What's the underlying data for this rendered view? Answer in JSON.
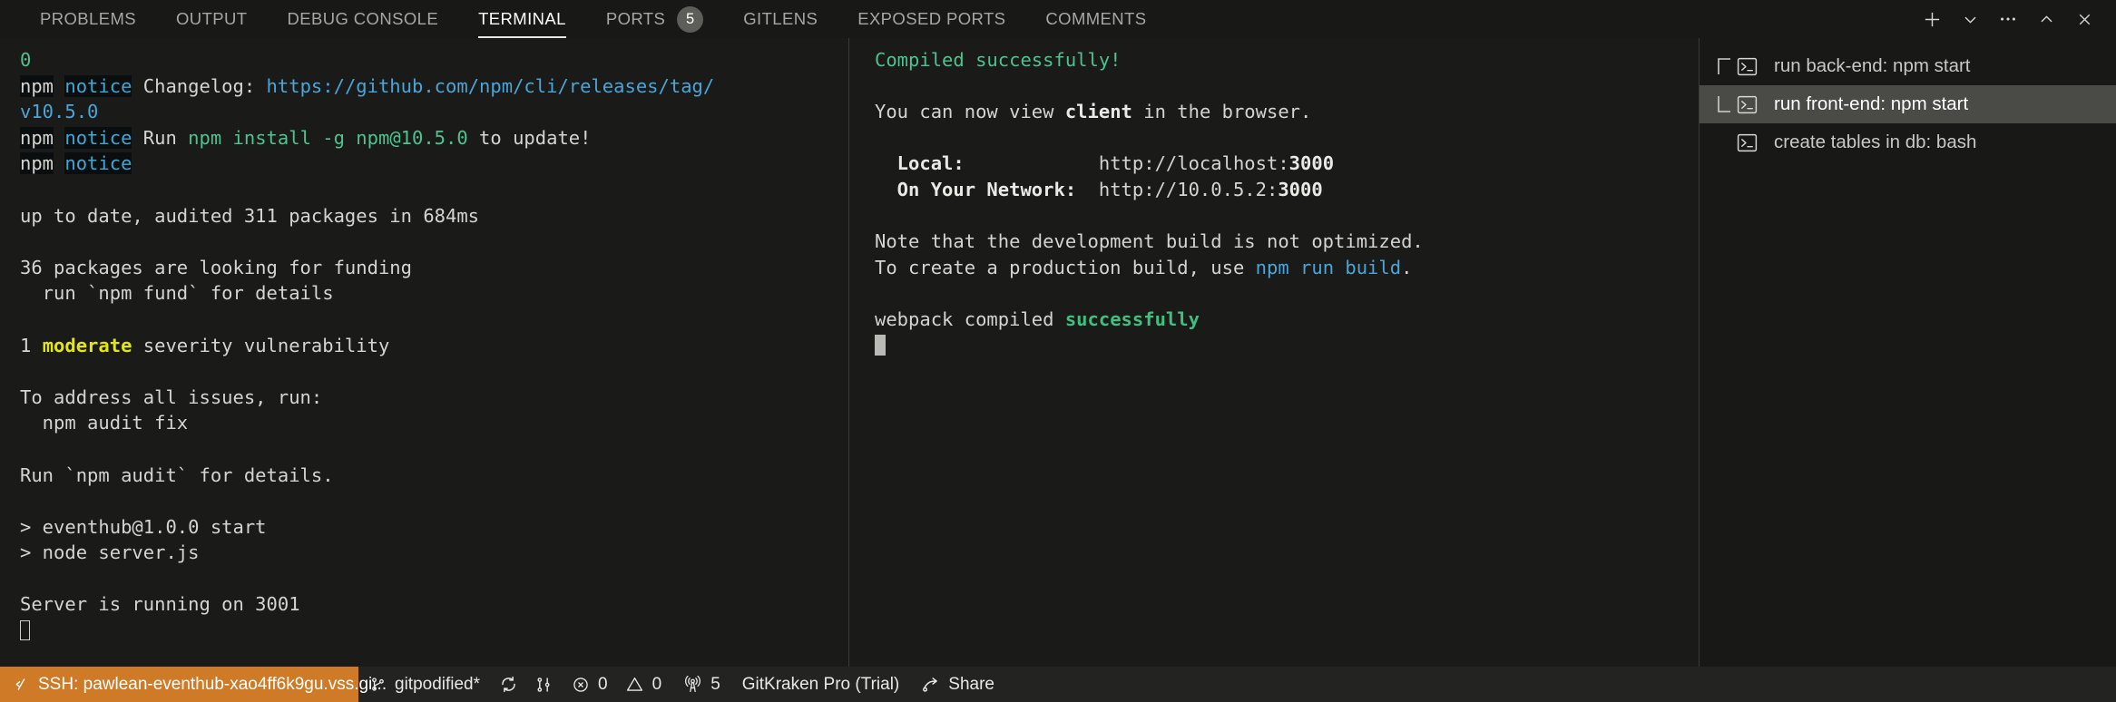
{
  "panel": {
    "tabs": [
      {
        "label": "PROBLEMS",
        "active": false,
        "badge": null
      },
      {
        "label": "OUTPUT",
        "active": false,
        "badge": null
      },
      {
        "label": "DEBUG CONSOLE",
        "active": false,
        "badge": null
      },
      {
        "label": "TERMINAL",
        "active": true,
        "badge": null
      },
      {
        "label": "PORTS",
        "active": false,
        "badge": "5"
      },
      {
        "label": "GITLENS",
        "active": false,
        "badge": null
      },
      {
        "label": "EXPOSED PORTS",
        "active": false,
        "badge": null
      },
      {
        "label": "COMMENTS",
        "active": false,
        "badge": null
      }
    ],
    "actions": [
      {
        "name": "new-terminal-icon",
        "glyph": "plus"
      },
      {
        "name": "terminal-profile-chevron-down-icon",
        "glyph": "chevron-down"
      },
      {
        "name": "panel-more-actions-icon",
        "glyph": "ellipsis"
      },
      {
        "name": "maximize-panel-chevron-up-icon",
        "glyph": "chevron-up"
      },
      {
        "name": "close-panel-icon",
        "glyph": "close"
      }
    ]
  },
  "terminal_left": {
    "name": "run back-end: npm start",
    "lines": [
      {
        "segments": [
          {
            "t": "0",
            "cls": "c-green"
          }
        ]
      },
      {
        "segments": [
          {
            "t": "npm",
            "cls": "hl"
          },
          {
            "t": " ",
            "cls": ""
          },
          {
            "t": "notice",
            "cls": "hl c-blue"
          },
          {
            "t": " Changelog: ",
            "cls": ""
          },
          {
            "t": "https://github.com/npm/cli/releases/tag/",
            "cls": "c-cyan"
          }
        ]
      },
      {
        "segments": [
          {
            "t": "v10.5.0",
            "cls": "c-cyan"
          }
        ]
      },
      {
        "segments": [
          {
            "t": "npm",
            "cls": "hl"
          },
          {
            "t": " ",
            "cls": ""
          },
          {
            "t": "notice",
            "cls": "hl c-blue"
          },
          {
            "t": " Run ",
            "cls": ""
          },
          {
            "t": "npm install -g npm@10.5.0",
            "cls": "c-green"
          },
          {
            "t": " to update!",
            "cls": ""
          }
        ]
      },
      {
        "segments": [
          {
            "t": "npm",
            "cls": "hl"
          },
          {
            "t": " ",
            "cls": ""
          },
          {
            "t": "notice",
            "cls": "hl c-blue"
          }
        ]
      },
      {
        "segments": [
          {
            "t": " ",
            "cls": ""
          }
        ]
      },
      {
        "segments": [
          {
            "t": "up to date, audited 311 packages in 684ms",
            "cls": ""
          }
        ]
      },
      {
        "segments": [
          {
            "t": " ",
            "cls": ""
          }
        ]
      },
      {
        "segments": [
          {
            "t": "36 packages are looking for funding",
            "cls": ""
          }
        ]
      },
      {
        "segments": [
          {
            "t": "  run `npm fund` for details",
            "cls": ""
          }
        ]
      },
      {
        "segments": [
          {
            "t": " ",
            "cls": ""
          }
        ]
      },
      {
        "segments": [
          {
            "t": "1 ",
            "cls": ""
          },
          {
            "t": "moderate",
            "cls": "c-yellow bold"
          },
          {
            "t": " severity vulnerability",
            "cls": ""
          }
        ]
      },
      {
        "segments": [
          {
            "t": " ",
            "cls": ""
          }
        ]
      },
      {
        "segments": [
          {
            "t": "To address all issues, run:",
            "cls": ""
          }
        ]
      },
      {
        "segments": [
          {
            "t": "  npm audit fix",
            "cls": ""
          }
        ]
      },
      {
        "segments": [
          {
            "t": " ",
            "cls": ""
          }
        ]
      },
      {
        "segments": [
          {
            "t": "Run `npm audit` for details.",
            "cls": ""
          }
        ]
      },
      {
        "segments": [
          {
            "t": " ",
            "cls": ""
          }
        ]
      },
      {
        "segments": [
          {
            "t": "> eventhub@1.0.0 start",
            "cls": ""
          }
        ]
      },
      {
        "segments": [
          {
            "t": "> node server.js",
            "cls": ""
          }
        ]
      },
      {
        "segments": [
          {
            "t": " ",
            "cls": ""
          }
        ]
      },
      {
        "segments": [
          {
            "t": "Server is running on 3001",
            "cls": ""
          }
        ]
      },
      {
        "segments": [
          {
            "t": "",
            "cls": "",
            "cursor": "hollow"
          }
        ]
      }
    ]
  },
  "terminal_right": {
    "name": "run front-end: npm start",
    "lines": [
      {
        "segments": [
          {
            "t": "Compiled successfully!",
            "cls": "c-green"
          }
        ]
      },
      {
        "segments": [
          {
            "t": " ",
            "cls": ""
          }
        ]
      },
      {
        "segments": [
          {
            "t": "You can now view ",
            "cls": ""
          },
          {
            "t": "client",
            "cls": "bold c-white"
          },
          {
            "t": " in the browser.",
            "cls": ""
          }
        ]
      },
      {
        "segments": [
          {
            "t": " ",
            "cls": ""
          }
        ]
      },
      {
        "segments": [
          {
            "t": "  Local:",
            "cls": "bold c-white"
          },
          {
            "t": "            http://localhost:",
            "cls": ""
          },
          {
            "t": "3000",
            "cls": "bold c-white"
          }
        ]
      },
      {
        "segments": [
          {
            "t": "  On Your Network:",
            "cls": "bold c-white"
          },
          {
            "t": "  http://10.0.5.2:",
            "cls": ""
          },
          {
            "t": "3000",
            "cls": "bold c-white"
          }
        ]
      },
      {
        "segments": [
          {
            "t": " ",
            "cls": ""
          }
        ]
      },
      {
        "segments": [
          {
            "t": "Note that the development build is not optimized.",
            "cls": ""
          }
        ]
      },
      {
        "segments": [
          {
            "t": "To create a production build, use ",
            "cls": ""
          },
          {
            "t": "npm run build",
            "cls": "c-cyan"
          },
          {
            "t": ".",
            "cls": ""
          }
        ]
      },
      {
        "segments": [
          {
            "t": " ",
            "cls": ""
          }
        ]
      },
      {
        "segments": [
          {
            "t": "webpack compiled ",
            "cls": ""
          },
          {
            "t": "successfully",
            "cls": "c-green2 bold"
          }
        ]
      },
      {
        "segments": [
          {
            "t": "",
            "cls": "",
            "cursor": "solid"
          }
        ]
      }
    ]
  },
  "terminal_list": {
    "items": [
      {
        "label": "run back-end: npm start",
        "branch": "top",
        "selected": false,
        "icon": "terminal-icon"
      },
      {
        "label": "run front-end: npm start",
        "branch": "bottom",
        "selected": true,
        "icon": "terminal-icon"
      },
      {
        "label": "create tables in db: bash",
        "branch": "none",
        "selected": false,
        "icon": "terminal-icon"
      }
    ]
  },
  "statusbar": {
    "remote": {
      "label": "SSH: pawlean-eventhub-xao4ff6k9gu.vss.gi...",
      "icon": "remote-indicator-icon",
      "color": "#cf7a26"
    },
    "branch": {
      "label": "gitpodified*",
      "icon": "source-control-branch-icon"
    },
    "sync": {
      "icon": "sync-icon"
    },
    "pull_request": {
      "icon": "git-pull-request-icon"
    },
    "errors": {
      "label": "0",
      "icon": "error-circle-icon"
    },
    "warnings": {
      "label": "0",
      "icon": "warning-triangle-icon"
    },
    "ports": {
      "label": "5",
      "icon": "radio-tower-icon"
    },
    "gitkraken": {
      "label": "GitKraken Pro (Trial)"
    },
    "share": {
      "label": "Share",
      "icon": "share-icon"
    }
  }
}
